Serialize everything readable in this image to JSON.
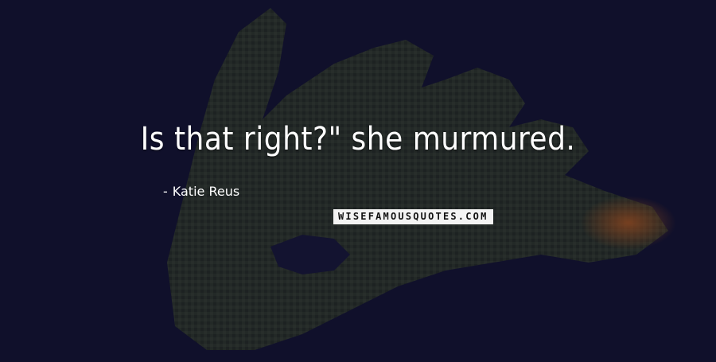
{
  "quote": {
    "text": "Is that right?\" she murmured."
  },
  "author": {
    "dash": "-",
    "name": "Katie Reus"
  },
  "brand": {
    "text": "WISEFAMOUSQUOTES.COM"
  },
  "background": {
    "description_icon": "blocky-hand-island-icon",
    "colors": {
      "sky": "#141433",
      "land": "#3d4a2e",
      "fire": "#c0581e"
    }
  }
}
